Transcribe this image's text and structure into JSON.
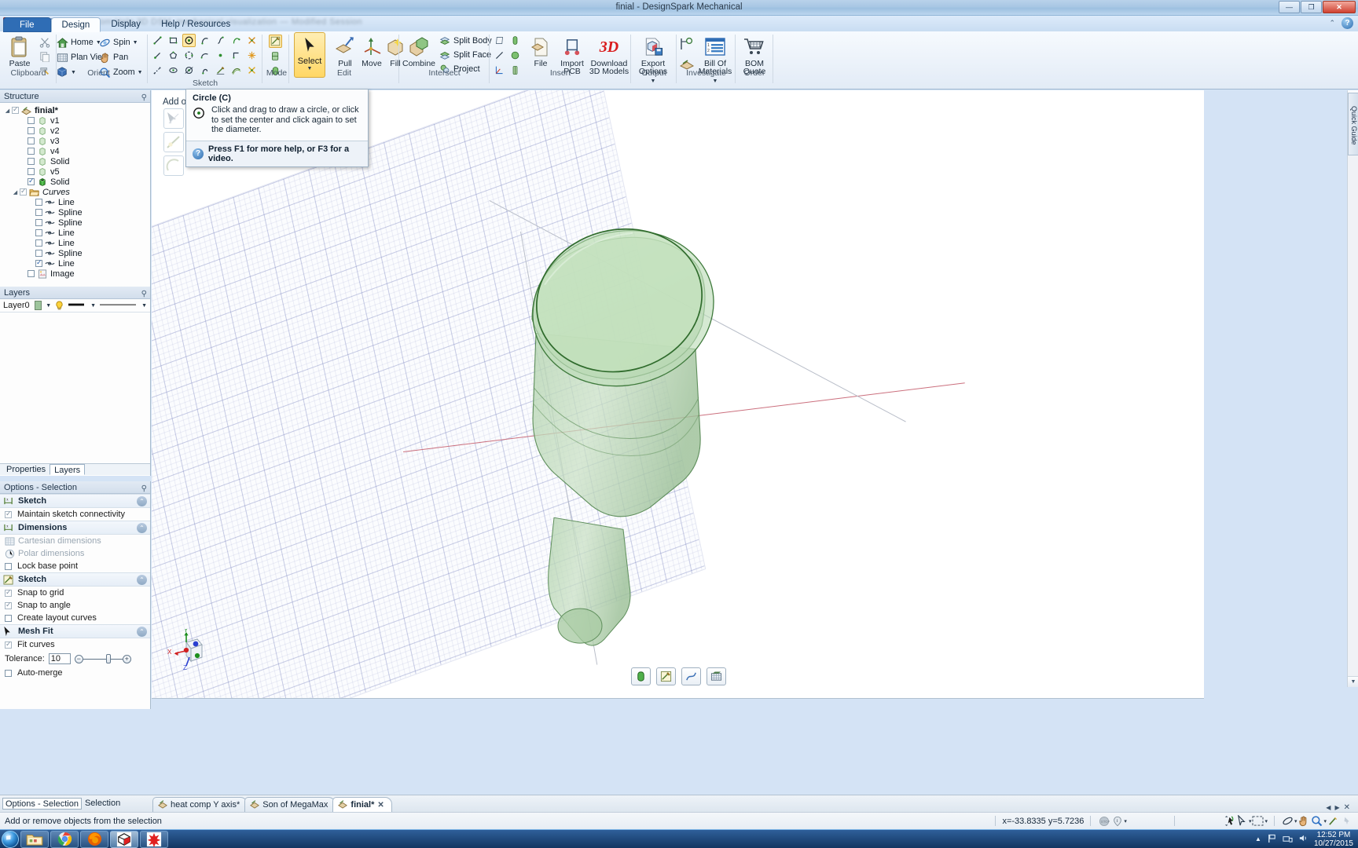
{
  "window": {
    "title": "finial - DesignSpark Mechanical",
    "minimize": "—",
    "maximize": "❐",
    "close": "✕"
  },
  "quick_access": {
    "blurred_text": "Zoom  Help  3D  DSM_mechanical  visualization  —  Modified  Session"
  },
  "ribbon": {
    "tabs": [
      {
        "label": "File",
        "state": "file"
      },
      {
        "label": "Design",
        "state": "active"
      },
      {
        "label": "Display",
        "state": "idle"
      },
      {
        "label": "Help / Resources",
        "state": "idle"
      }
    ],
    "groups": [
      {
        "name": "Clipboard",
        "big": [
          {
            "label": "Paste",
            "icon": "clipboard-icon"
          }
        ],
        "small": [
          {
            "label": "",
            "icon": "cut-scissors-icon"
          },
          {
            "label": "",
            "icon": "copy-icon"
          },
          {
            "label": "",
            "icon": "format-painter-icon"
          }
        ]
      },
      {
        "name": "Orient",
        "small": [
          {
            "label": "Home",
            "icon": "home-icon",
            "has_caret": true
          },
          {
            "label": "Plan View",
            "icon": "plan-view-icon"
          },
          {
            "label": "",
            "icon": "view-cube-icon",
            "has_caret": true
          },
          {
            "label": "Spin",
            "icon": "spin-icon",
            "has_caret": true
          },
          {
            "label": "Pan",
            "icon": "pan-hand-icon"
          },
          {
            "label": "Zoom",
            "icon": "zoom-magnifier-icon",
            "has_caret": true
          }
        ]
      },
      {
        "name": "Sketch",
        "icons": [
          "line-icon",
          "rectangle-icon",
          "circle-icon",
          "tangent-arc-icon",
          "spline-icon",
          "arc-3point-icon",
          "trim-away-icon",
          "line-point-icon",
          "polygon-icon",
          "three-point-circle-icon",
          "arc-icon",
          "point-icon",
          "corner-rectangle-icon",
          "construction-point-icon",
          "dashed-line-icon",
          "ellipse-icon",
          "circle-tangent-icon",
          "sweep-arc-icon",
          "edit-sketch-icon",
          "offset-curve-icon",
          "split-curve-icon"
        ],
        "selected_icon": "circle-icon"
      },
      {
        "name": "Mode",
        "icons": [
          "sketch-mode-icon",
          "section-mode-icon",
          "3d-mode-icon"
        ],
        "selected_icon": "sketch-mode-icon"
      },
      {
        "name": "Edit",
        "big": [
          {
            "label": "Select",
            "icon": "cursor-arrow-icon",
            "selected": true,
            "has_caret": true
          },
          {
            "label": "Pull",
            "icon": "pull-icon"
          },
          {
            "label": "Move",
            "icon": "move-icon"
          },
          {
            "label": "Fill",
            "icon": "fill-icon"
          }
        ]
      },
      {
        "name": "Intersect",
        "big": [
          {
            "label": "Combine",
            "icon": "combine-icon"
          }
        ],
        "small": [
          {
            "label": "Split Body",
            "icon": "split-body-icon"
          },
          {
            "label": "Split Face",
            "icon": "split-face-icon"
          },
          {
            "label": "Project",
            "icon": "project-icon"
          }
        ]
      },
      {
        "name": "Insert",
        "icons": [
          "plane-icon",
          "cylinder-axis-icon",
          "line-axis-icon",
          "sphere-origin-icon",
          "origin-axes-icon",
          "coordinate-system-icon"
        ],
        "big": [
          {
            "label": "File",
            "icon": "insert-file-icon"
          },
          {
            "label": "Import PCB",
            "icon": "import-pcb-icon"
          },
          {
            "label": "Download 3D Models",
            "icon": "download-3d-icon"
          }
        ]
      },
      {
        "name": "Output",
        "big": [
          {
            "label": "Export Options",
            "icon": "export-options-icon",
            "has_caret": true
          }
        ]
      },
      {
        "name": "Investigate",
        "small_icons": [
          "measure-icon",
          "mass-properties-icon"
        ],
        "big": [
          {
            "label": "Bill Of Materials",
            "icon": "bom-list-icon",
            "has_caret": true
          }
        ]
      },
      {
        "name": "Order",
        "big": [
          {
            "label": "BOM Quote",
            "icon": "shopping-cart-icon"
          }
        ]
      }
    ]
  },
  "structure_panel": {
    "title": "Structure",
    "items": [
      {
        "label": "finial*",
        "indent": 0,
        "checked": true,
        "dim": true,
        "bold": true,
        "italic": false,
        "icon": "document-icon",
        "expander": "▲"
      },
      {
        "label": "v1",
        "indent": 2,
        "checked": false,
        "icon": "body-light-icon"
      },
      {
        "label": "v2",
        "indent": 2,
        "checked": false,
        "icon": "body-light-icon"
      },
      {
        "label": "v3",
        "indent": 2,
        "checked": false,
        "icon": "body-light-icon"
      },
      {
        "label": "v4",
        "indent": 2,
        "checked": false,
        "icon": "body-light-icon"
      },
      {
        "label": "Solid",
        "indent": 2,
        "checked": false,
        "icon": "body-light-icon"
      },
      {
        "label": "v5",
        "indent": 2,
        "checked": false,
        "icon": "body-light-icon"
      },
      {
        "label": "Solid",
        "indent": 2,
        "checked": true,
        "icon": "body-solid-icon"
      },
      {
        "label": "Curves",
        "indent": 1,
        "checked": true,
        "dim": true,
        "italic": true,
        "icon": "folder-icon",
        "expander": "▲"
      },
      {
        "label": "Line",
        "indent": 3,
        "checked": false,
        "icon": "curve-icon"
      },
      {
        "label": "Spline",
        "indent": 3,
        "checked": false,
        "icon": "curve-icon"
      },
      {
        "label": "Spline",
        "indent": 3,
        "checked": false,
        "icon": "curve-icon"
      },
      {
        "label": "Line",
        "indent": 3,
        "checked": false,
        "icon": "curve-icon"
      },
      {
        "label": "Line",
        "indent": 3,
        "checked": false,
        "icon": "curve-icon"
      },
      {
        "label": "Spline",
        "indent": 3,
        "checked": false,
        "icon": "curve-icon"
      },
      {
        "label": "Line",
        "indent": 3,
        "checked": true,
        "icon": "curve-icon"
      },
      {
        "label": "Image",
        "indent": 2,
        "checked": false,
        "icon": "image-icon"
      }
    ]
  },
  "layers_panel": {
    "title": "Layers",
    "layer_name": "Layer0",
    "color_hex": "#9ec59c",
    "visibility_icon": "lightbulb-icon",
    "line_style_icon": "line-style-icon"
  },
  "panel_tabs": [
    {
      "label": "Properties",
      "selected": false
    },
    {
      "label": "Layers",
      "selected": true
    }
  ],
  "options_panel": {
    "title": "Options - Selection",
    "sections": [
      {
        "title": "Sketch",
        "icon": "dimension-icon",
        "rows": [
          {
            "label": "Maintain sketch connectivity",
            "checked": true,
            "disabled": false
          }
        ]
      },
      {
        "title": "Dimensions",
        "icon": "dimension-icon",
        "rows": [
          {
            "label": "Cartesian dimensions",
            "checked": false,
            "disabled": true,
            "icon": "grid-icon"
          },
          {
            "label": "Polar dimensions",
            "checked": false,
            "disabled": true,
            "icon": "polar-icon"
          },
          {
            "label": "Lock base point",
            "checked": false,
            "disabled": false
          }
        ]
      },
      {
        "title": "Sketch",
        "icon": "sketch-pencil-icon",
        "rows": [
          {
            "label": "Snap to grid",
            "checked": true,
            "disabled": false
          },
          {
            "label": "Snap to angle",
            "checked": true,
            "disabled": false
          },
          {
            "label": "Create layout curves",
            "checked": false,
            "disabled": false
          }
        ]
      },
      {
        "title": "Mesh Fit",
        "icon": "cursor-arrow-icon",
        "rows": [
          {
            "label": "Fit curves",
            "checked": true,
            "disabled": false
          }
        ],
        "tolerance": {
          "label": "Tolerance:",
          "value": "10",
          "minus": "−",
          "plus": "+"
        },
        "extra_rows": [
          {
            "label": "Auto-merge",
            "checked": false,
            "disabled": false
          }
        ]
      }
    ]
  },
  "tooltip": {
    "title": "Circle (C)",
    "icon": "circle-icon",
    "body": "Click and drag to draw a circle, or click to set the center and click again to set the diameter.",
    "footer": "Press F1 for more help, or F3 for a video.",
    "footer_icon": "help-icon"
  },
  "viewport": {
    "sketch_hint": "Add o",
    "bottom_buttons": [
      {
        "icon": "solid-body-icon",
        "name": "show-solid"
      },
      {
        "icon": "sketch-mode-icon",
        "name": "show-sketch"
      },
      {
        "icon": "curves-icon",
        "name": "show-curves"
      },
      {
        "icon": "grid-icon",
        "name": "show-grid"
      }
    ],
    "gizmo_axes": [
      {
        "label": "X",
        "color": "#cc2222"
      },
      {
        "label": "Y",
        "color": "#1d7d1d"
      },
      {
        "label": "Z",
        "color": "#2222cc"
      }
    ]
  },
  "quick_guide": {
    "label": "Quick Guide"
  },
  "document_tabs": [
    {
      "label": "heat comp Y axis*",
      "active": false,
      "closable": false
    },
    {
      "label": "Son of MegaMax",
      "active": false,
      "closable": false
    },
    {
      "label": "finial*",
      "active": true,
      "closable": true,
      "close_glyph": "✕"
    }
  ],
  "options_status": {
    "left": "Options - Selection",
    "right": "Selection"
  },
  "status_bar": {
    "message": "Add or remove objects from the selection",
    "coordinates": "x=-33.8335  y=5.7236",
    "right_icons": [
      "spin-tool-icon",
      "select-tool-icon",
      "box-select-icon",
      "orbit-icon",
      "pan-hand-icon",
      "zoom-magnifier-icon",
      "paint-icon",
      "pin-icon"
    ]
  },
  "taskbar": {
    "start": "start-orb-icon",
    "buttons": [
      {
        "icon": "file-explorer-icon",
        "name": "file-explorer"
      },
      {
        "icon": "chrome-icon",
        "name": "google-chrome"
      },
      {
        "icon": "firefox-icon",
        "name": "mozilla-firefox"
      },
      {
        "icon": "designspark-icon",
        "name": "designspark-mechanical",
        "active": true
      },
      {
        "icon": "red-splat-icon",
        "name": "inkscape"
      }
    ],
    "tray_icons": [
      "chevron-up-icon",
      "flag-icon",
      "network-icon",
      "volume-icon"
    ],
    "time": "12:52 PM",
    "date": "10/27/2015"
  }
}
